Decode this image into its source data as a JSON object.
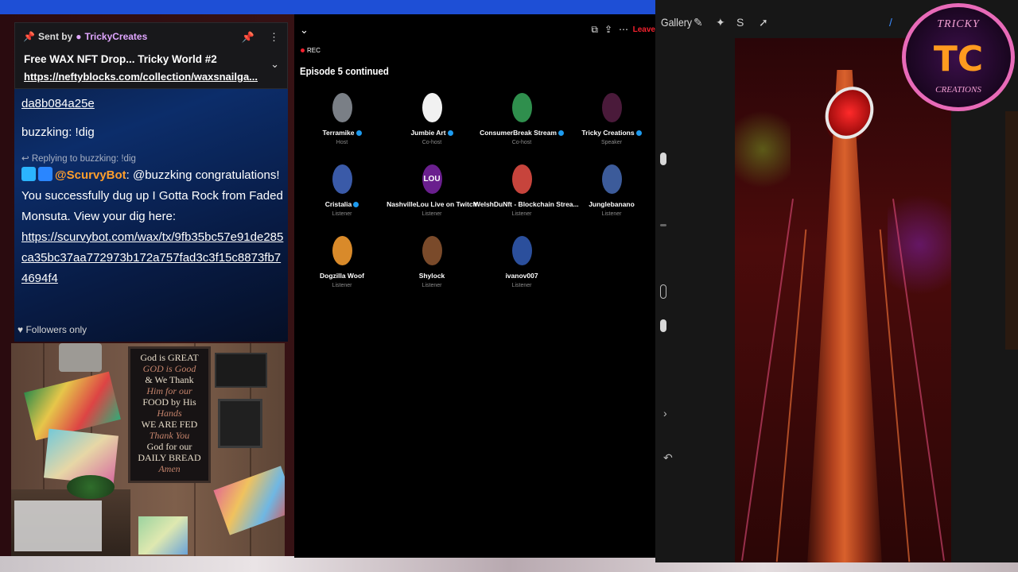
{
  "chat": {
    "pinned": {
      "sent_by_label": "Sent by",
      "creator": "TrickyCreates",
      "title": "Free WAX NFT Drop... Tricky World #2",
      "link": "https://neftyblocks.com/collection/waxsnailga..."
    },
    "messages": [
      {
        "text": "da8b084a25e"
      },
      {
        "text": "buzzking: !dig"
      }
    ],
    "reply_to": "Replying to buzzking: !dig",
    "bot": {
      "name": "@ScurvyBot",
      "text": ": @buzzking congratulations! You successfully dug up I Gotta Rock from Faded Monsuta. View your dig here:",
      "link": "https://scurvybot.com/wax/tx/9fb35bc57e91de285ca35bc37aa772973b172a757fad3c3f15c8873fb74694f4"
    },
    "followers_only": "Followers only"
  },
  "webcam": {
    "sign_lines": [
      "God is GREAT",
      "GOD is Good",
      "& We Thank",
      "Him for our",
      "FOOD by His",
      "Hands",
      "WE ARE FED",
      "Thank You",
      "God for our",
      "DAILY BREAD",
      "Amen"
    ]
  },
  "space": {
    "rec_label": "REC",
    "leave_label": "Leave",
    "title": "Episode 5 continued",
    "participants": [
      {
        "name": "Terramike",
        "role": "Host",
        "color": "#7a7f86",
        "verified": true
      },
      {
        "name": "Jumbie Art",
        "role": "Co-host",
        "color": "#f1f1f1",
        "verified": true
      },
      {
        "name": "ConsumerBreak Stream",
        "role": "Co-host",
        "color": "#2f8f4d",
        "verified": true
      },
      {
        "name": "Tricky Creations",
        "role": "Speaker",
        "color": "#4a1a3a",
        "verified": true
      },
      {
        "name": "Cristalia",
        "role": "Listener",
        "color": "#3a5aa8",
        "verified": true
      },
      {
        "name": "NashvilleLou Live on Twitch",
        "role": "Listener",
        "color": "#6a1f8e",
        "verified": false
      },
      {
        "name": "WelshDuNft - Blockchain Strea...",
        "role": "Listener",
        "color": "#c7443c",
        "verified": false
      },
      {
        "name": "Junglebanano",
        "role": "Listener",
        "color": "#3c5b9a",
        "verified": false
      },
      {
        "name": "Dogzilla Woof",
        "role": "Listener",
        "color": "#d98a2a",
        "verified": false
      },
      {
        "name": "Shylock",
        "role": "Listener",
        "color": "#7a4a2a",
        "verified": false
      },
      {
        "name": "ivanov007",
        "role": "Listener",
        "color": "#2b4f9c",
        "verified": false
      }
    ],
    "avatar_text_lou": "LOU"
  },
  "procreate": {
    "gallery_label": "Gallery"
  },
  "logo": {
    "top_text": "TRICKY",
    "mono": "TC",
    "bottom_text": "CREATIONS"
  }
}
